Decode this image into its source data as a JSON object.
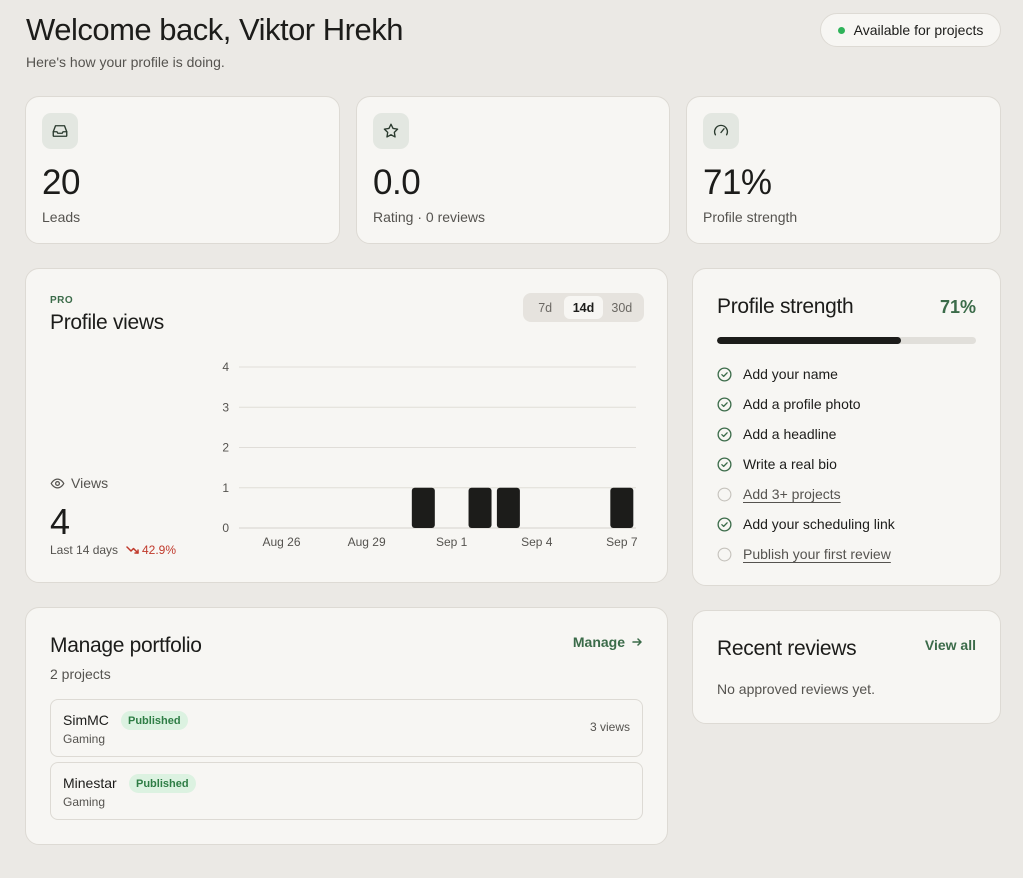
{
  "header": {
    "title": "Welcome back, Viktor Hrekh",
    "subtitle": "Here's how your profile is doing.",
    "availability": "Available for projects",
    "availability_color": "#2fb35a"
  },
  "stats": [
    {
      "icon": "inbox-icon",
      "value": "20",
      "label": "Leads"
    },
    {
      "icon": "star-icon",
      "value": "0.0",
      "label": "Rating · 0 reviews"
    },
    {
      "icon": "gauge-icon",
      "value": "71%",
      "label": "Profile strength"
    }
  ],
  "profile_views": {
    "tag": "PRO",
    "title": "Profile views",
    "ranges": [
      "7d",
      "14d",
      "30d"
    ],
    "active_range": "14d",
    "views_label": "Views",
    "views_value": "4",
    "period": "Last 14 days",
    "change": "42.9%",
    "change_color": "#c0392b"
  },
  "chart_data": {
    "type": "bar",
    "categories": [
      "Aug 25",
      "Aug 26",
      "Aug 27",
      "Aug 28",
      "Aug 29",
      "Aug 30",
      "Aug 31",
      "Sep 1",
      "Sep 2",
      "Sep 3",
      "Sep 4",
      "Sep 5",
      "Sep 6",
      "Sep 7"
    ],
    "values": [
      0,
      0,
      0,
      0,
      0,
      0,
      1,
      0,
      1,
      1,
      0,
      0,
      0,
      1
    ],
    "x_tick_labels": [
      "Aug 26",
      "Aug 29",
      "Sep 1",
      "Sep 4",
      "Sep 7"
    ],
    "y_ticks": [
      "0",
      "1",
      "2",
      "3",
      "4"
    ],
    "ylim": [
      0,
      4
    ],
    "grid": true,
    "bar_color": "#1c1c1a"
  },
  "profile_strength": {
    "title": "Profile strength",
    "percent_label": "71%",
    "percent": 71,
    "items": [
      {
        "label": "Add your name",
        "done": true
      },
      {
        "label": "Add a profile photo",
        "done": true
      },
      {
        "label": "Add a headline",
        "done": true
      },
      {
        "label": "Write a real bio",
        "done": true
      },
      {
        "label": "Add 3+ projects",
        "done": false
      },
      {
        "label": "Add your scheduling link",
        "done": true
      },
      {
        "label": "Publish your first review",
        "done": false
      }
    ]
  },
  "portfolio": {
    "title": "Manage portfolio",
    "manage_label": "Manage",
    "count": "2 projects",
    "projects": [
      {
        "name": "SimMC",
        "status": "Published",
        "category": "Gaming",
        "views": "3 views"
      },
      {
        "name": "Minestar",
        "status": "Published",
        "category": "Gaming",
        "views": ""
      }
    ]
  },
  "reviews": {
    "title": "Recent reviews",
    "view_all": "View all",
    "empty": "No approved reviews yet."
  }
}
